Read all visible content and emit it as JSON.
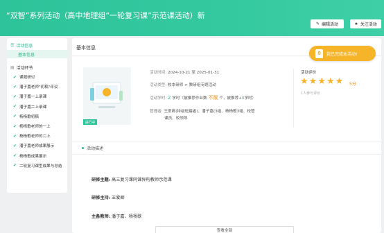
{
  "header": {
    "title": "“双智”系列活动（高中地理组“一轮复习课”示范课活动）新",
    "buttons": [
      {
        "label": "编辑活动",
        "icon": "edit-icon"
      },
      {
        "label": "关注活动",
        "icon": "star-icon"
      }
    ]
  },
  "sidebar": {
    "info_heading": "活动信息",
    "info_item": "基本信息",
    "steps_heading": "活动环节",
    "steps": [
      "课题研讨",
      "潘子嘉老师\"初稿\"评议",
      "潘子嘉一上录课",
      "潘子嘉二上录课",
      "杨杨歌初稿",
      "杨杨歌老师的一上",
      "杨杨歌老师的二上",
      "潘子嘉老师成果展示",
      "杨杨歌成果展示",
      "二轮复习课型成果与总结"
    ]
  },
  "main": {
    "section_title": "基本信息",
    "review_button": "我已完成本活动!",
    "cover_status": "进行中",
    "info": {
      "time_label": "活动时间:",
      "time_value": "2024-10-21 至 2025-01-31",
      "type_label": "活动类型:",
      "type_value": "校本研修 > 教研组专题活动",
      "credit_label": "活动学时:",
      "credit_main": "2",
      "credit_text1": "学时（被推荐作业数",
      "credit_status": "不限",
      "credit_text2": "个，被推荐+",
      "credit_extra": "0",
      "credit_text3": "学时）",
      "manager_label": "管理者:",
      "manager_value_line1": "王爱卿(特级班建者)、潘子嘉(3组、杨杨歌3组、校管",
      "manager_value_line2": "课员、校领导"
    },
    "evaluation": {
      "title": "活动评价",
      "stars": 5,
      "score": "5分",
      "raters": "1人参与评价"
    },
    "description": {
      "title": "活动描述",
      "topic_label": "研修主题:",
      "topic_value": "高三复习课同课异构教师示范课",
      "leader_label": "研修主持:",
      "leader_value": "王爱卿",
      "teacher_label": "主备教师:",
      "teacher_value": "潘子嘉、杨杨歌"
    },
    "view_all": "查看全部"
  },
  "colors": {
    "accent": "#2ec39a",
    "orange": "#f6b428",
    "text_orange": "#f08c1e"
  }
}
